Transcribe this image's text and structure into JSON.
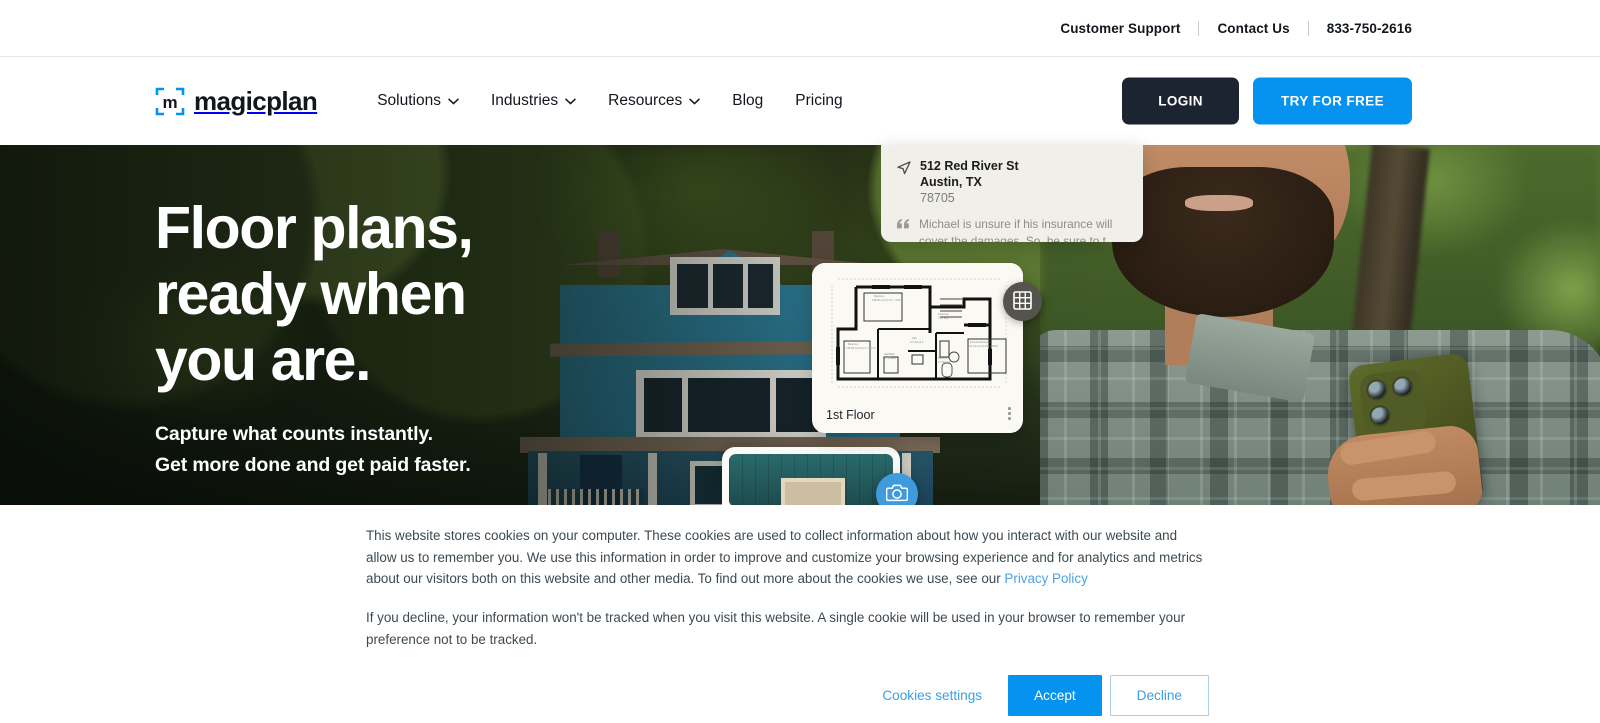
{
  "utility_bar": {
    "customer_support": "Customer Support",
    "contact_us": "Contact Us",
    "phone": "833-750-2616"
  },
  "brand": {
    "logo_letter": "m",
    "name": "magicplan"
  },
  "nav": {
    "items": [
      {
        "label": "Solutions",
        "has_dropdown": true
      },
      {
        "label": "Industries",
        "has_dropdown": true
      },
      {
        "label": "Resources",
        "has_dropdown": true
      },
      {
        "label": "Blog",
        "has_dropdown": false
      },
      {
        "label": "Pricing",
        "has_dropdown": false
      }
    ],
    "login_label": "LOGIN",
    "try_label": "TRY FOR FREE"
  },
  "hero": {
    "title_line1": "Floor plans,",
    "title_line2": "ready when",
    "title_line3": "you are.",
    "sub_line1": "Capture what counts instantly.",
    "sub_line2": "Get more done and get paid faster."
  },
  "cards": {
    "address": {
      "street": "512 Red River St",
      "city": "Austin, TX",
      "zip": "78705",
      "note": "Michael is unsure if his insurance will cover the damages. So, be sure to t..."
    },
    "floorplan": {
      "label": "1st Floor"
    }
  },
  "cookie": {
    "paragraph1_a": "This website stores cookies on your computer. These cookies are used to collect information about how you interact with our website and allow us to remember you. We use this information in order to improve and customize your browsing experience and for analytics and metrics about our visitors both on this website and other media. To find out more about the cookies we use, see our ",
    "privacy_link": "Privacy Policy",
    "paragraph2": "If you decline, your information won't be tracked when you visit this website. A single cookie will be used in your browser to remember your preference not to be tracked.",
    "settings_label": "Cookies settings",
    "accept_label": "Accept",
    "decline_label": "Decline"
  },
  "colors": {
    "accent_blue": "#0593ef",
    "dark_navy": "#1b2430",
    "link_blue": "#3ba0e8",
    "text_dark": "#11171d"
  }
}
